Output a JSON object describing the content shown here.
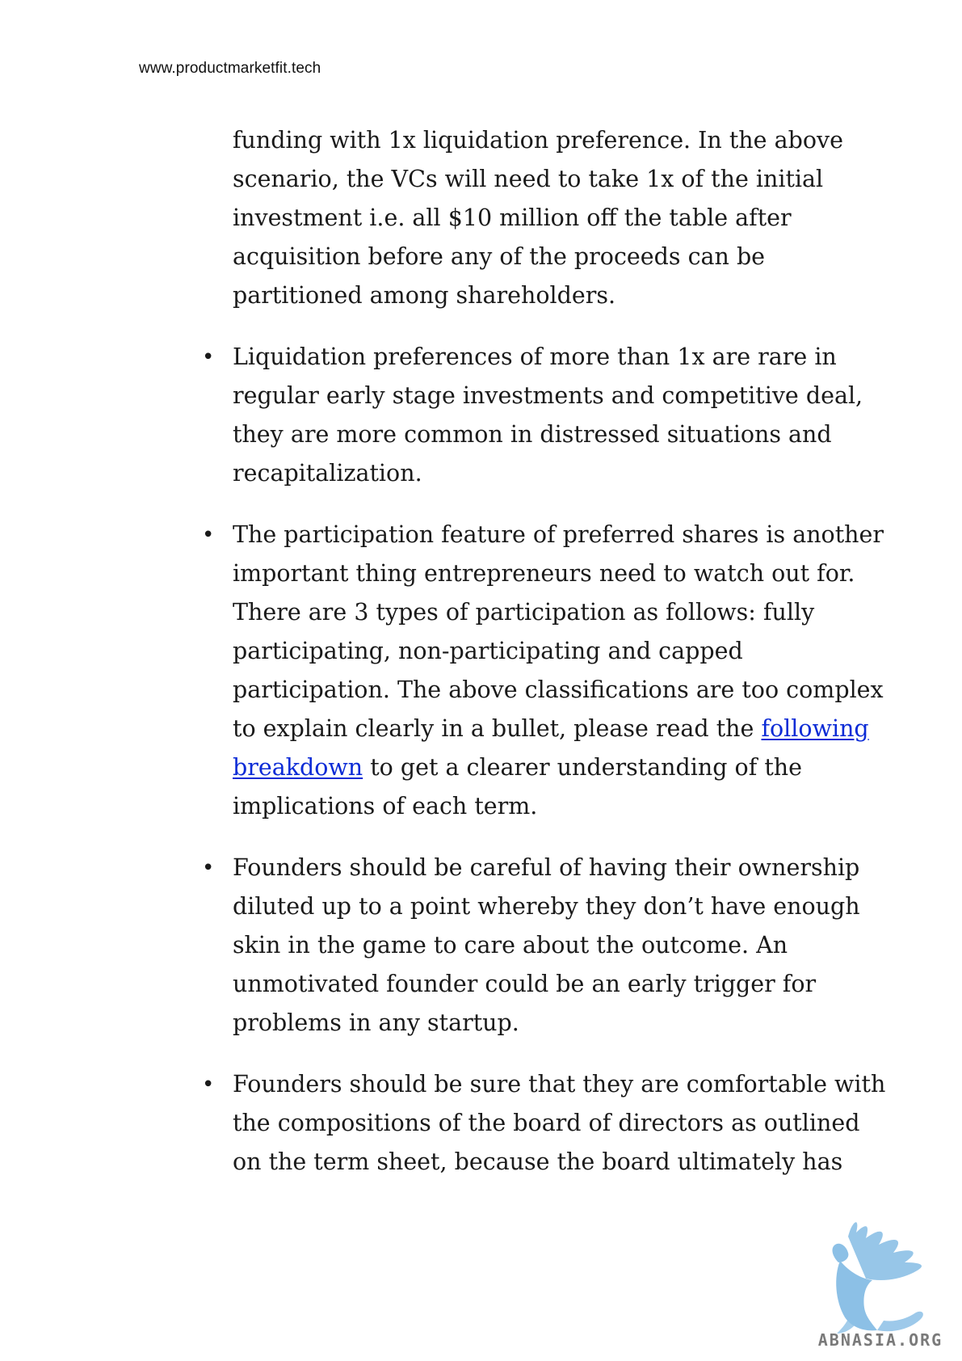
{
  "header": {
    "url": "www.productmarketfit.tech"
  },
  "intro_lines": [
    "funding with 1x liquidation preference. In the above",
    "scenario, the VCs will need to take 1x of the initial",
    "investment i.e. all $10 million off the table after",
    "acquisition before any of the proceeds can be",
    "partitioned among shareholders."
  ],
  "bullet_symbol": "•",
  "bullets": [
    {
      "lines": [
        "Liquidation preferences of more than 1x are rare in",
        "regular early stage investments and competitive deal,",
        "they are more common in distressed situations and",
        "recapitalization."
      ]
    },
    {
      "lines": [
        "The participation feature of preferred shares is another",
        "important thing entrepreneurs need to watch out for.",
        "There are 3 types of participation as follows: fully",
        "participating, non-participating and capped",
        "participation. The above classifications are too complex"
      ],
      "link_line_prefix": "to explain clearly in a bullet, please read the ",
      "link_text_part1": "following",
      "link_text_part2": "breakdown",
      "link_line_suffix": " to get a clearer understanding of the",
      "last_line": "implications of each term."
    },
    {
      "lines": [
        "Founders should be careful of having their ownership",
        "diluted up to a point whereby they don’t have enough",
        "skin in the game to care about the outcome. An",
        "unmotivated founder could be an early trigger for",
        "problems in any startup."
      ]
    },
    {
      "lines": [
        "Founders should be sure that they are comfortable with",
        "the compositions of the board of directors as outlined",
        "on the term sheet, because the board ultimately has"
      ]
    }
  ],
  "watermark": {
    "text": "ABNASIA.ORG",
    "icon": "griffin-logo-icon",
    "color": "#7fb6e0"
  },
  "colors": {
    "link": "#0b2bd6",
    "text": "#1a1a1a"
  }
}
